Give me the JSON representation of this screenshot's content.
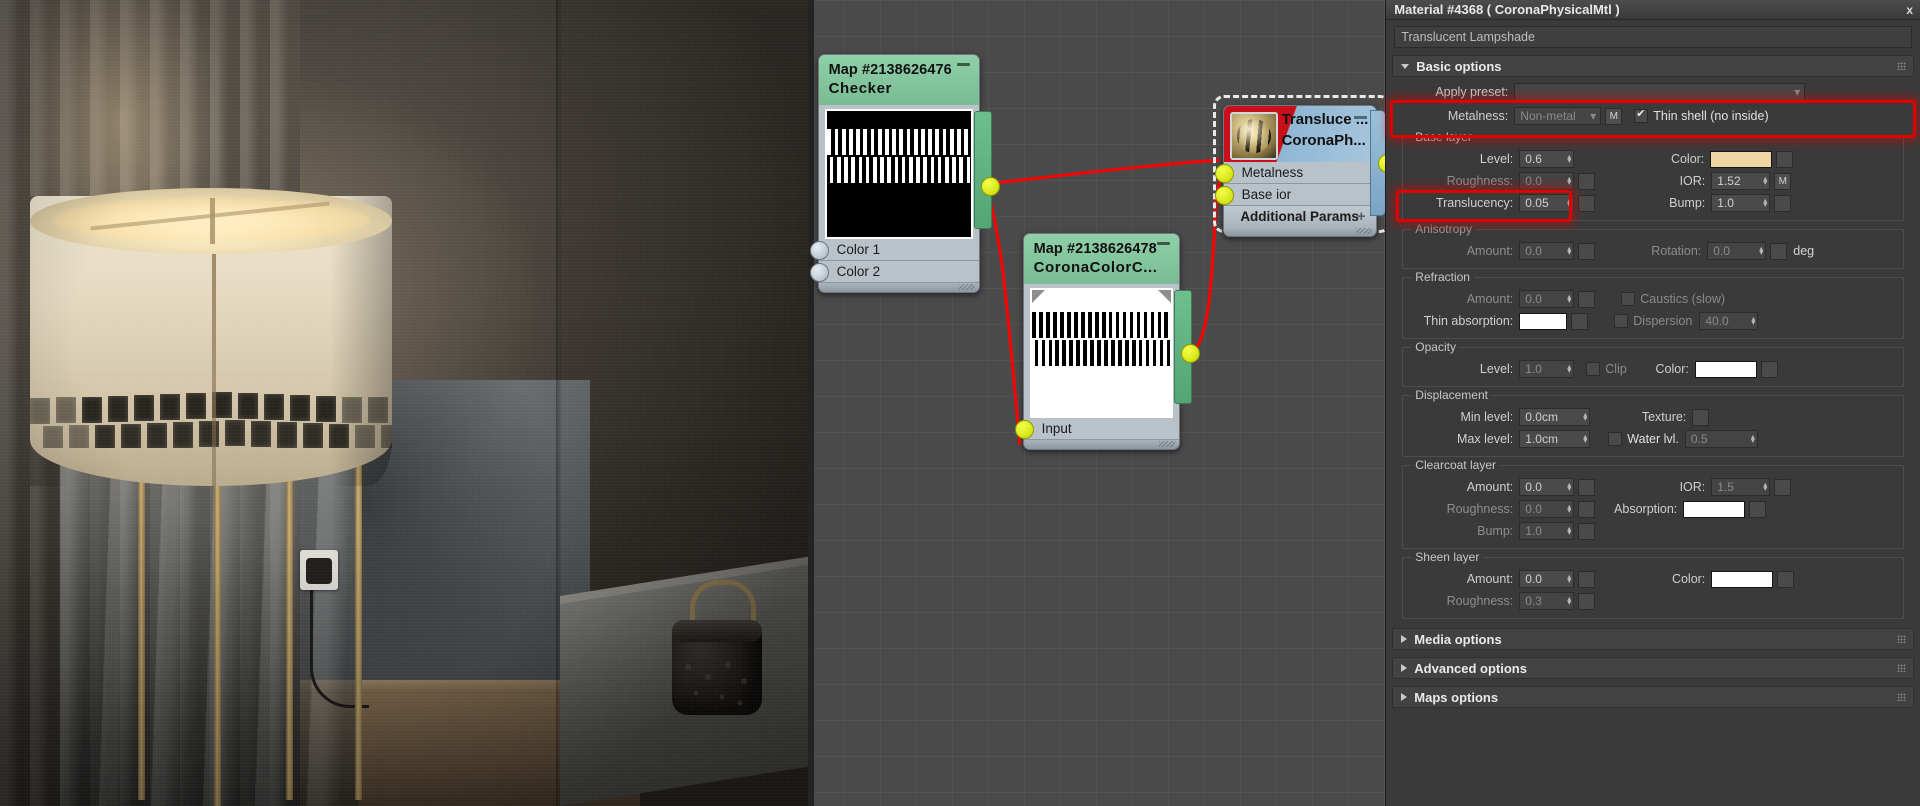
{
  "render": {
    "description": "3D rendered interior scene: floor lamp with translucent checkered lampshade, curtain, wall outlet, side table with lantern"
  },
  "node_editor": {
    "nodes": [
      {
        "id": "Map #2138626476",
        "type": "Checker",
        "minimize_icon": "minimize-icon",
        "thumbnail": "checker-pattern-dark",
        "inputs": [
          "Color 1",
          "Color 2"
        ],
        "outputs": [
          "output"
        ]
      },
      {
        "id": "Map #2138626478",
        "type": "CoronaColorC...",
        "minimize_icon": "minimize-icon",
        "thumbnail": "checker-pattern-light",
        "inputs": [
          "Input"
        ],
        "outputs": [
          "output"
        ]
      },
      {
        "id": "Transluce ...",
        "type": "CoronaPh...",
        "minimize_icon": "minimize-icon",
        "preview": "material-sphere-preview",
        "inputs": [
          "Metalness",
          "Base ior"
        ],
        "extra_row": "Additional Params",
        "extra_row_icon": "plus-icon",
        "selected": true
      }
    ],
    "wire_color": "#ff0000",
    "socket_color": "#e8f500"
  },
  "panel": {
    "titlebar": {
      "text": "Material #4368  ( CoronaPhysicalMtl )",
      "close_icon": "close-icon"
    },
    "material_name": "Translucent Lampshade",
    "rollouts": {
      "basic": {
        "label": "Basic options",
        "expanded": true,
        "grip_icon": "grip-icon"
      },
      "media": {
        "label": "Media options",
        "expanded": false,
        "grip_icon": "grip-icon"
      },
      "advanced": {
        "label": "Advanced options",
        "expanded": false,
        "grip_icon": "grip-icon"
      },
      "maps": {
        "label": "Maps options",
        "expanded": false,
        "grip_icon": "grip-icon"
      }
    },
    "apply_preset": {
      "label": "Apply preset:",
      "value": "",
      "dropdown_icon": "chevron-down-icon"
    },
    "metalness": {
      "label": "Metalness:",
      "value": "Non-metal",
      "dropdown_icon": "chevron-down-icon",
      "map_button": "M",
      "thin_shell_label": "Thin shell (no inside)",
      "thin_shell_checked": true,
      "highlighted": true
    },
    "base_layer": {
      "title": "Base layer",
      "level": {
        "label": "Level:",
        "value": "0.6"
      },
      "color": {
        "label": "Color:",
        "value": "#f0d5a5"
      },
      "roughness": {
        "label": "Roughness:",
        "value": "0.0"
      },
      "ior": {
        "label": "IOR:",
        "value": "1.52",
        "map_button": "M"
      },
      "translucency": {
        "label": "Translucency:",
        "value": "0.05",
        "highlighted": true
      },
      "bump": {
        "label": "Bump:",
        "value": "1.0"
      }
    },
    "anisotropy": {
      "title": "Anisotropy",
      "amount": {
        "label": "Amount:",
        "value": "0.0"
      },
      "rotation": {
        "label": "Rotation:",
        "value": "0.0",
        "unit": "deg"
      }
    },
    "refraction": {
      "title": "Refraction",
      "amount": {
        "label": "Amount:",
        "value": "0.0"
      },
      "caustics": {
        "label": "Caustics (slow)",
        "checked": false
      },
      "thin_absorption": {
        "label": "Thin absorption:",
        "value": "#ffffff"
      },
      "dispersion": {
        "label": "Dispersion",
        "checked": false,
        "value": "40.0"
      }
    },
    "opacity": {
      "title": "Opacity",
      "level": {
        "label": "Level:",
        "value": "1.0"
      },
      "clip": {
        "label": "Clip",
        "checked": false
      },
      "color": {
        "label": "Color:",
        "value": "#ffffff"
      }
    },
    "displacement": {
      "title": "Displacement",
      "min_level": {
        "label": "Min level:",
        "value": "0.0cm"
      },
      "texture": {
        "label": "Texture:"
      },
      "max_level": {
        "label": "Max level:",
        "value": "1.0cm"
      },
      "water_lvl": {
        "label": "Water lvl.",
        "value": "0.5",
        "checked": false
      }
    },
    "clearcoat": {
      "title": "Clearcoat layer",
      "amount": {
        "label": "Amount:",
        "value": "0.0"
      },
      "ior": {
        "label": "IOR:",
        "value": "1.5"
      },
      "roughness": {
        "label": "Roughness:",
        "value": "0.0"
      },
      "absorption": {
        "label": "Absorption:",
        "value": "#ffffff"
      },
      "bump": {
        "label": "Bump:",
        "value": "1.0"
      }
    },
    "sheen": {
      "title": "Sheen layer",
      "amount": {
        "label": "Amount:",
        "value": "0.0"
      },
      "color": {
        "label": "Color:",
        "value": "#ffffff"
      },
      "roughness": {
        "label": "Roughness:",
        "value": "0.3"
      }
    }
  }
}
